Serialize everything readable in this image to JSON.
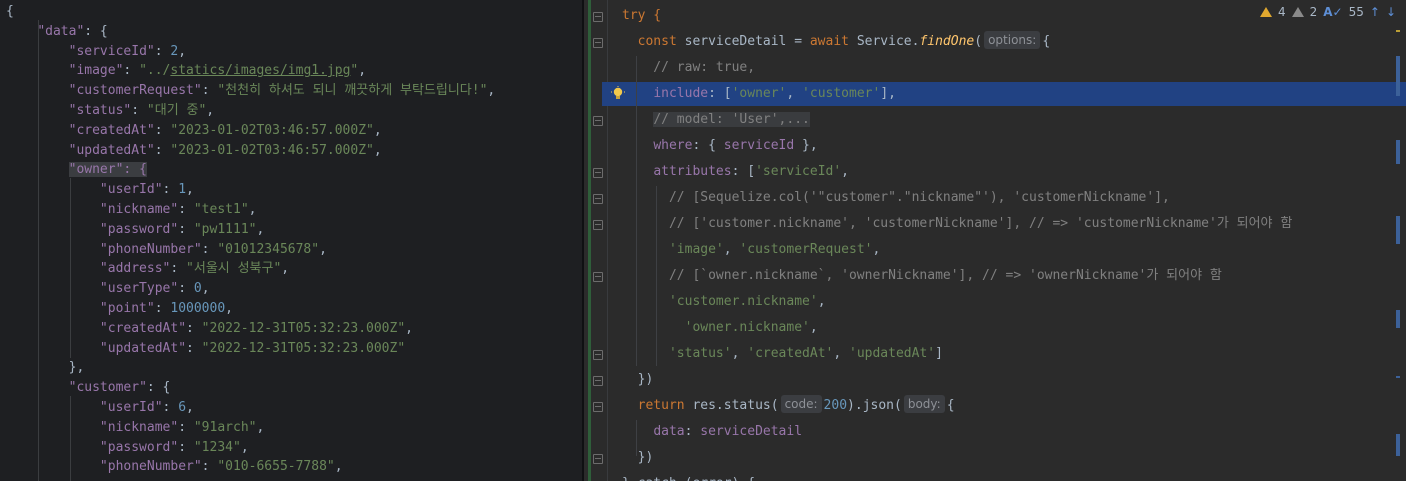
{
  "json_panel": {
    "lines": [
      [
        {
          "t": "{",
          "c": "jp"
        }
      ],
      [
        {
          "t": "    ",
          "c": "jp"
        },
        {
          "t": "\"data\"",
          "c": "jk"
        },
        {
          "t": ": {",
          "c": "jp"
        }
      ],
      [
        {
          "t": "        ",
          "c": "jp"
        },
        {
          "t": "\"serviceId\"",
          "c": "jk"
        },
        {
          "t": ": ",
          "c": "jp"
        },
        {
          "t": "2",
          "c": "jn"
        },
        {
          "t": ",",
          "c": "jp"
        }
      ],
      [
        {
          "t": "        ",
          "c": "jp"
        },
        {
          "t": "\"image\"",
          "c": "jk"
        },
        {
          "t": ": ",
          "c": "jp"
        },
        {
          "t": "\"../",
          "c": "js"
        },
        {
          "t": "statics/images/img1.jpg",
          "c": "jlink"
        },
        {
          "t": "\"",
          "c": "js"
        },
        {
          "t": ",",
          "c": "jp"
        }
      ],
      [
        {
          "t": "        ",
          "c": "jp"
        },
        {
          "t": "\"customerRequest\"",
          "c": "jk"
        },
        {
          "t": ": ",
          "c": "jp"
        },
        {
          "t": "\"천천히 하셔도 되니 깨끗하게 부탁드립니다!\"",
          "c": "js"
        },
        {
          "t": ",",
          "c": "jp"
        }
      ],
      [
        {
          "t": "        ",
          "c": "jp"
        },
        {
          "t": "\"status\"",
          "c": "jk"
        },
        {
          "t": ": ",
          "c": "jp"
        },
        {
          "t": "\"대기 중\"",
          "c": "js"
        },
        {
          "t": ",",
          "c": "jp"
        }
      ],
      [
        {
          "t": "        ",
          "c": "jp"
        },
        {
          "t": "\"createdAt\"",
          "c": "jk"
        },
        {
          "t": ": ",
          "c": "jp"
        },
        {
          "t": "\"2023-01-02T03:46:57.000Z\"",
          "c": "js"
        },
        {
          "t": ",",
          "c": "jp"
        }
      ],
      [
        {
          "t": "        ",
          "c": "jp"
        },
        {
          "t": "\"updatedAt\"",
          "c": "jk"
        },
        {
          "t": ": ",
          "c": "jp"
        },
        {
          "t": "\"2023-01-02T03:46:57.000Z\"",
          "c": "js"
        },
        {
          "t": ",",
          "c": "jp"
        }
      ],
      [
        {
          "t": "        ",
          "c": "jp"
        },
        {
          "t": "\"owner\": {",
          "c": "jk owner-hl"
        }
      ],
      [
        {
          "t": "            ",
          "c": "jp"
        },
        {
          "t": "\"userId\"",
          "c": "jk"
        },
        {
          "t": ": ",
          "c": "jp"
        },
        {
          "t": "1",
          "c": "jn"
        },
        {
          "t": ",",
          "c": "jp"
        }
      ],
      [
        {
          "t": "            ",
          "c": "jp"
        },
        {
          "t": "\"nickname\"",
          "c": "jk"
        },
        {
          "t": ": ",
          "c": "jp"
        },
        {
          "t": "\"test1\"",
          "c": "js"
        },
        {
          "t": ",",
          "c": "jp"
        }
      ],
      [
        {
          "t": "            ",
          "c": "jp"
        },
        {
          "t": "\"password\"",
          "c": "jk"
        },
        {
          "t": ": ",
          "c": "jp"
        },
        {
          "t": "\"pw1111\"",
          "c": "js"
        },
        {
          "t": ",",
          "c": "jp"
        }
      ],
      [
        {
          "t": "            ",
          "c": "jp"
        },
        {
          "t": "\"phoneNumber\"",
          "c": "jk"
        },
        {
          "t": ": ",
          "c": "jp"
        },
        {
          "t": "\"01012345678\"",
          "c": "js"
        },
        {
          "t": ",",
          "c": "jp"
        }
      ],
      [
        {
          "t": "            ",
          "c": "jp"
        },
        {
          "t": "\"address\"",
          "c": "jk"
        },
        {
          "t": ": ",
          "c": "jp"
        },
        {
          "t": "\"서울시 성북구\"",
          "c": "js"
        },
        {
          "t": ",",
          "c": "jp"
        }
      ],
      [
        {
          "t": "            ",
          "c": "jp"
        },
        {
          "t": "\"userType\"",
          "c": "jk"
        },
        {
          "t": ": ",
          "c": "jp"
        },
        {
          "t": "0",
          "c": "jn"
        },
        {
          "t": ",",
          "c": "jp"
        }
      ],
      [
        {
          "t": "            ",
          "c": "jp"
        },
        {
          "t": "\"point\"",
          "c": "jk"
        },
        {
          "t": ": ",
          "c": "jp"
        },
        {
          "t": "1000000",
          "c": "jn"
        },
        {
          "t": ",",
          "c": "jp"
        }
      ],
      [
        {
          "t": "            ",
          "c": "jp"
        },
        {
          "t": "\"createdAt\"",
          "c": "jk"
        },
        {
          "t": ": ",
          "c": "jp"
        },
        {
          "t": "\"2022-12-31T05:32:23.000Z\"",
          "c": "js"
        },
        {
          "t": ",",
          "c": "jp"
        }
      ],
      [
        {
          "t": "            ",
          "c": "jp"
        },
        {
          "t": "\"updatedAt\"",
          "c": "jk"
        },
        {
          "t": ": ",
          "c": "jp"
        },
        {
          "t": "\"2022-12-31T05:32:23.000Z\"",
          "c": "js"
        }
      ],
      [
        {
          "t": "        },",
          "c": "jp"
        }
      ],
      [
        {
          "t": "        ",
          "c": "jp"
        },
        {
          "t": "\"customer\"",
          "c": "jk"
        },
        {
          "t": ": {",
          "c": "jp"
        }
      ],
      [
        {
          "t": "            ",
          "c": "jp"
        },
        {
          "t": "\"userId\"",
          "c": "jk"
        },
        {
          "t": ": ",
          "c": "jp"
        },
        {
          "t": "6",
          "c": "jn"
        },
        {
          "t": ",",
          "c": "jp"
        }
      ],
      [
        {
          "t": "            ",
          "c": "jp"
        },
        {
          "t": "\"nickname\"",
          "c": "jk"
        },
        {
          "t": ": ",
          "c": "jp"
        },
        {
          "t": "\"91arch\"",
          "c": "js"
        },
        {
          "t": ",",
          "c": "jp"
        }
      ],
      [
        {
          "t": "            ",
          "c": "jp"
        },
        {
          "t": "\"password\"",
          "c": "jk"
        },
        {
          "t": ": ",
          "c": "jp"
        },
        {
          "t": "\"1234\"",
          "c": "js"
        },
        {
          "t": ",",
          "c": "jp"
        }
      ],
      [
        {
          "t": "            ",
          "c": "jp"
        },
        {
          "t": "\"phoneNumber\"",
          "c": "jk"
        },
        {
          "t": ": ",
          "c": "jp"
        },
        {
          "t": "\"010-6655-7788\"",
          "c": "js"
        },
        {
          "t": ",",
          "c": "jp"
        }
      ]
    ]
  },
  "inspection": {
    "warnings": "4",
    "weak_warnings": "2",
    "typos": "55"
  },
  "code_editor": {
    "lines": [
      [
        {
          "t": "try {",
          "c": "kw"
        }
      ],
      [
        {
          "t": "  const ",
          "c": "kw"
        },
        {
          "t": "serviceDetail = ",
          "c": ""
        },
        {
          "t": "await ",
          "c": "kw"
        },
        {
          "t": "Service.",
          "c": ""
        },
        {
          "t": "findOne",
          "c": "fn"
        },
        {
          "t": "(",
          "c": ""
        },
        {
          "t": "options:",
          "c": "hint"
        },
        {
          "t": "{",
          "c": ""
        }
      ],
      [
        {
          "t": "    // raw: true,",
          "c": "com"
        }
      ],
      [
        {
          "t": "    ",
          "c": ""
        },
        {
          "t": "include",
          "c": "prop"
        },
        {
          "t": ": [",
          "c": ""
        },
        {
          "t": "'owner'",
          "c": "str"
        },
        {
          "t": ", ",
          "c": ""
        },
        {
          "t": "'customer'",
          "c": "str"
        },
        {
          "t": "],",
          "c": ""
        }
      ],
      [
        {
          "t": "    ",
          "c": ""
        },
        {
          "t": "// model: 'User',...",
          "c": "com fold-bg"
        }
      ],
      [
        {
          "t": "    ",
          "c": ""
        },
        {
          "t": "where",
          "c": "prop"
        },
        {
          "t": ": { ",
          "c": ""
        },
        {
          "t": "serviceId",
          "c": "var"
        },
        {
          "t": " },",
          "c": ""
        }
      ],
      [
        {
          "t": "    ",
          "c": ""
        },
        {
          "t": "attributes",
          "c": "prop"
        },
        {
          "t": ": [",
          "c": ""
        },
        {
          "t": "'serviceId'",
          "c": "str"
        },
        {
          "t": ",",
          "c": ""
        }
      ],
      [
        {
          "t": "      // [Sequelize.col('\"customer\".\"nickname\"'), 'customerNickname'],",
          "c": "com"
        }
      ],
      [
        {
          "t": "      // ['customer.nickname', 'customerNickname'], // => 'customerNickname'가 되어야 함",
          "c": "com"
        }
      ],
      [
        {
          "t": "      ",
          "c": ""
        },
        {
          "t": "'image'",
          "c": "str"
        },
        {
          "t": ", ",
          "c": ""
        },
        {
          "t": "'customerRequest'",
          "c": "str"
        },
        {
          "t": ",",
          "c": ""
        }
      ],
      [
        {
          "t": "      // [`owner.nickname`, 'ownerNickname'], // => 'ownerNickname'가 되어야 함",
          "c": "com"
        }
      ],
      [
        {
          "t": "      ",
          "c": ""
        },
        {
          "t": "'customer.nickname'",
          "c": "str"
        },
        {
          "t": ",",
          "c": ""
        }
      ],
      [
        {
          "t": "        ",
          "c": ""
        },
        {
          "t": "'owner.nickname'",
          "c": "str"
        },
        {
          "t": ",",
          "c": ""
        }
      ],
      [
        {
          "t": "      ",
          "c": ""
        },
        {
          "t": "'status'",
          "c": "str"
        },
        {
          "t": ", ",
          "c": ""
        },
        {
          "t": "'createdAt'",
          "c": "str"
        },
        {
          "t": ", ",
          "c": ""
        },
        {
          "t": "'updatedAt'",
          "c": "str"
        },
        {
          "t": "]",
          "c": ""
        }
      ],
      [
        {
          "t": "  })",
          "c": ""
        }
      ],
      [
        {
          "t": "  ",
          "c": ""
        },
        {
          "t": "return ",
          "c": "kw"
        },
        {
          "t": "res.",
          "c": ""
        },
        {
          "t": "status",
          "c": ""
        },
        {
          "t": "(",
          "c": ""
        },
        {
          "t": "code:",
          "c": "hint"
        },
        {
          "t": "200",
          "c": "num"
        },
        {
          "t": ").",
          "c": ""
        },
        {
          "t": "json",
          "c": ""
        },
        {
          "t": "(",
          "c": ""
        },
        {
          "t": "body:",
          "c": "hint"
        },
        {
          "t": "{",
          "c": ""
        }
      ],
      [
        {
          "t": "    ",
          "c": ""
        },
        {
          "t": "data",
          "c": "prop"
        },
        {
          "t": ": ",
          "c": ""
        },
        {
          "t": "serviceDetail",
          "c": "var"
        }
      ],
      [
        {
          "t": "  })",
          "c": ""
        }
      ],
      [
        {
          "t": "} catch (error) {",
          "c": ""
        }
      ]
    ]
  }
}
